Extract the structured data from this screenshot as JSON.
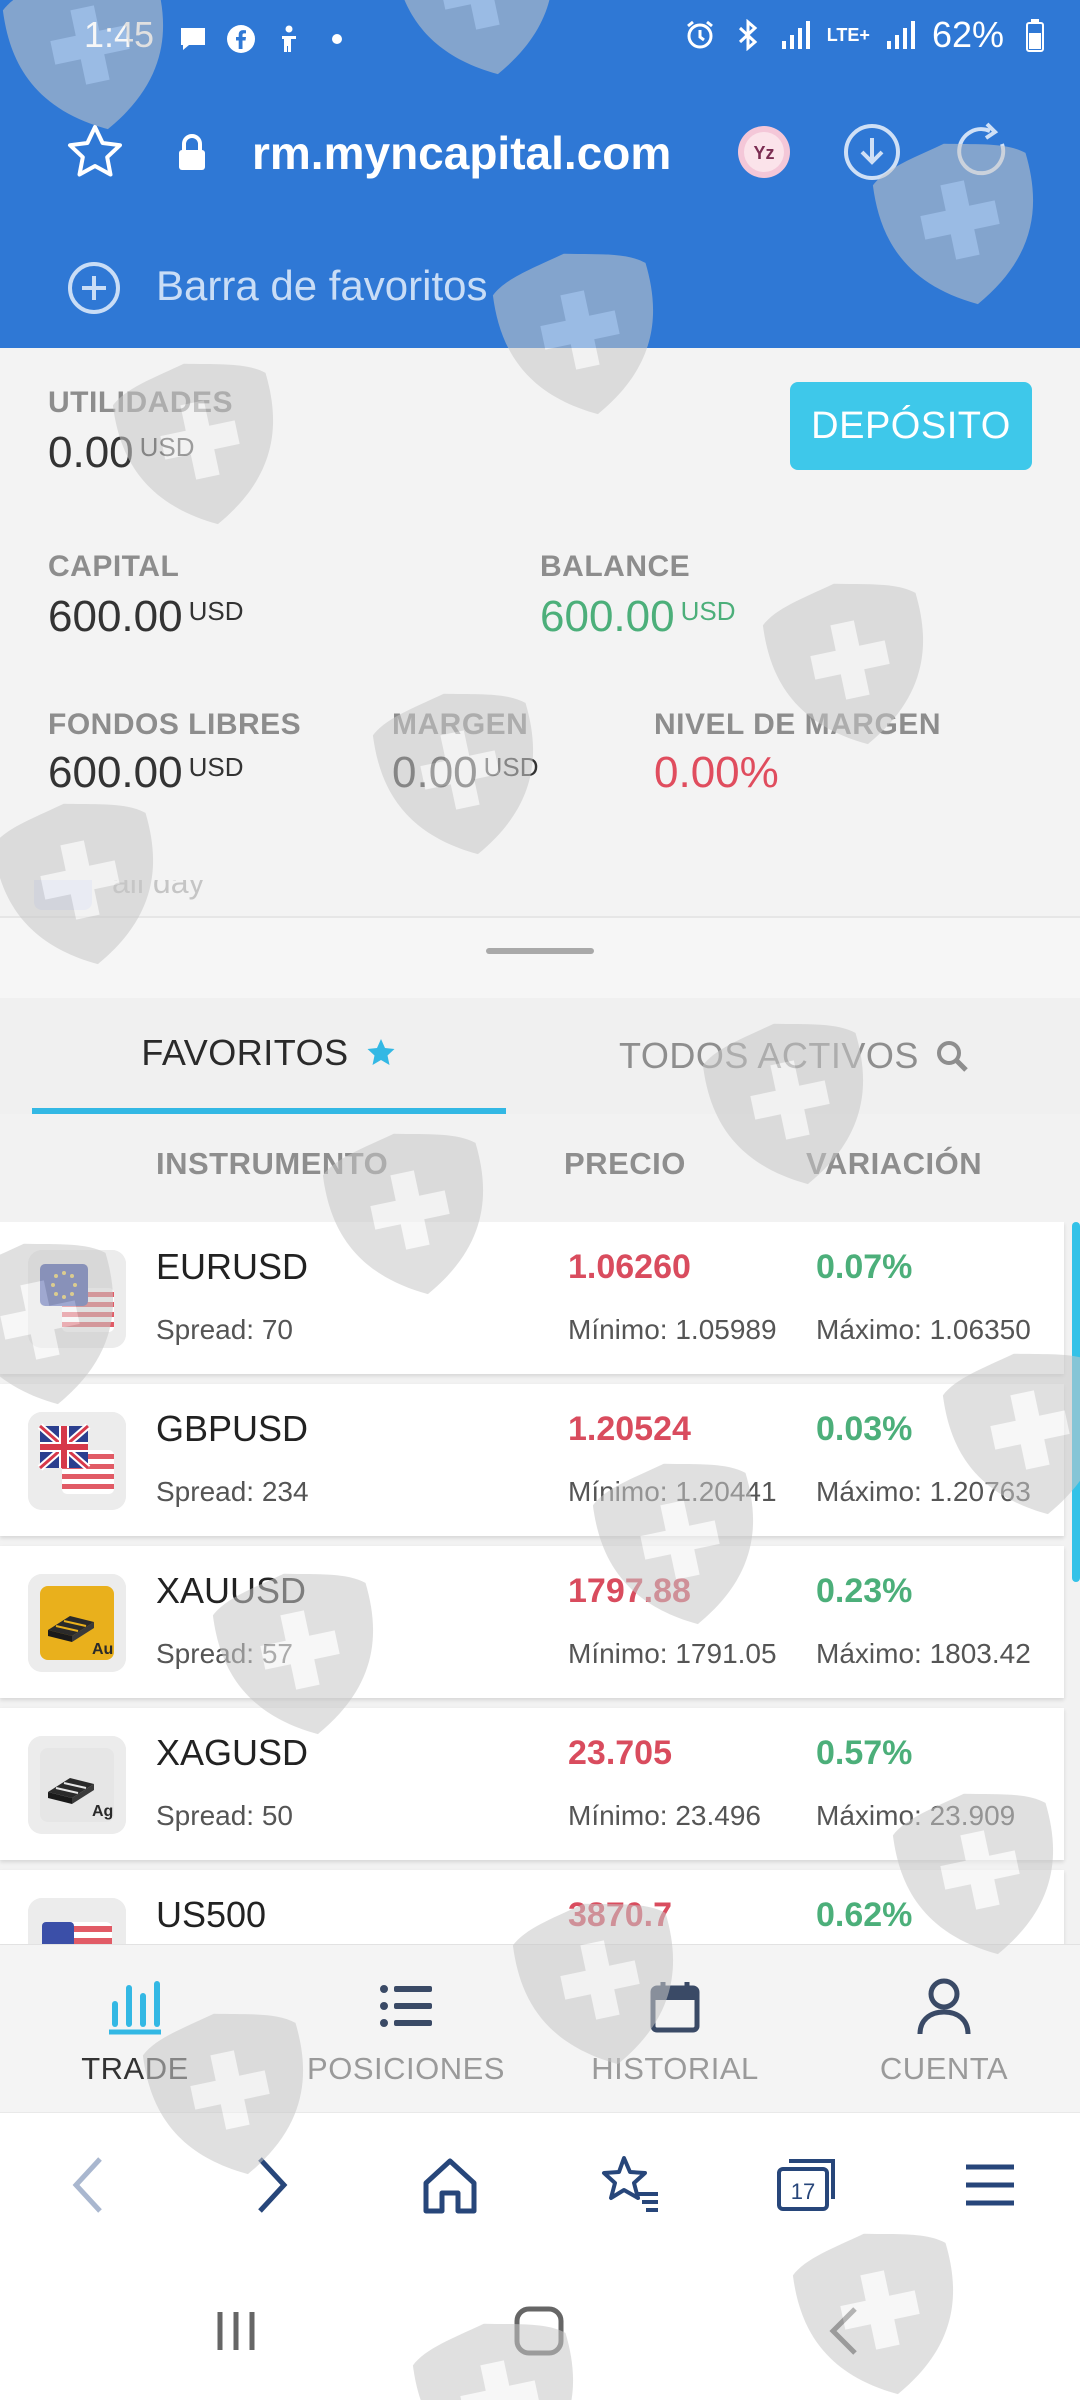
{
  "status_bar": {
    "time": "1:45",
    "battery": "62%",
    "network": "LTE+"
  },
  "browser": {
    "url": "rm.myncapital.com",
    "favorites_bar": "Barra de favoritos",
    "tab_count": "17"
  },
  "summary": {
    "utilidades": {
      "label": "UTILIDADES",
      "value": "0.00",
      "unit": "USD"
    },
    "deposit_button": "DEPÓSITO",
    "capital": {
      "label": "CAPITAL",
      "value": "600.00",
      "unit": "USD"
    },
    "balance": {
      "label": "BALANCE",
      "value": "600.00",
      "unit": "USD"
    },
    "fondos_libres": {
      "label": "FONDOS LIBRES",
      "value": "600.00",
      "unit": "USD"
    },
    "margen": {
      "label": "MARGEN",
      "value": "0.00",
      "unit": "USD"
    },
    "nivel_margen": {
      "label": "NIVEL DE MARGEN",
      "value": "0.00%"
    },
    "peek_text": "all day"
  },
  "tabs": {
    "favorites": "FAVORITOS",
    "all_assets": "TODOS ACTIVOS"
  },
  "table_header": {
    "instrument": "INSTRUMENTO",
    "price": "PRECIO",
    "change": "VARIACIÓN"
  },
  "instruments": [
    {
      "symbol": "EURUSD",
      "spread": "Spread: 70",
      "price": "1.06260",
      "change": "0.07%",
      "min": "Mínimo: 1.05989",
      "max": "Máximo: 1.06350",
      "icon": "eu-us-flag-icon"
    },
    {
      "symbol": "GBPUSD",
      "spread": "Spread: 234",
      "price": "1.20524",
      "change": "0.03%",
      "min": "Mínimo: 1.20441",
      "max": "Máximo: 1.20763",
      "icon": "gb-us-flag-icon"
    },
    {
      "symbol": "XAUUSD",
      "spread": "Spread: 57",
      "price": "1797.88",
      "change": "0.23%",
      "min": "Mínimo: 1791.05",
      "max": "Máximo: 1803.42",
      "icon": "gold-bar-icon",
      "badge": "Au"
    },
    {
      "symbol": "XAGUSD",
      "spread": "Spread: 50",
      "price": "23.705",
      "change": "0.57%",
      "min": "Mínimo: 23.496",
      "max": "Máximo: 23.909",
      "icon": "silver-bar-icon",
      "badge": "Ag"
    },
    {
      "symbol": "US500",
      "spread": "",
      "price": "3870.7",
      "change": "0.62%",
      "min": "",
      "max": "",
      "icon": "us-flag-icon"
    }
  ],
  "app_nav": {
    "trade": "TRADE",
    "positions": "POSICIONES",
    "history": "HISTORIAL",
    "account": "CUENTA"
  },
  "colors": {
    "browser_blue": "#2f78d5",
    "accent_cyan": "#3ec8ea",
    "price_red": "#d94c5e",
    "change_green": "#4caf7a"
  }
}
